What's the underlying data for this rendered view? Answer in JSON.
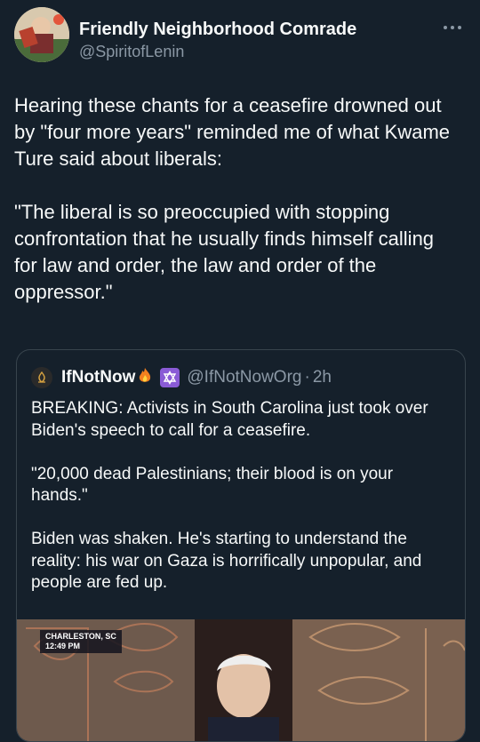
{
  "author": {
    "name": "Friendly Neighborhood Comrade",
    "handle": "@SpiritofLenin"
  },
  "more_icon": "more-horizontal-icon",
  "tweet_text": "Hearing these chants for a ceasefire drowned out by \"four more years\" reminded me of what Kwame Ture said about liberals:\n\n\"The liberal is so preoccupied with stopping confrontation that he usually finds himself calling for law and order, the law and order of the oppressor.\"",
  "quote": {
    "name": "IfNotNow",
    "handle": "@IfNotNowOrg",
    "separator": "·",
    "time": "2h",
    "text": "BREAKING: Activists in South Carolina just took over Biden's speech to call for a ceasefire.\n\n\"20,000 dead Palestinians; their blood is on your hands.\"\n\nBiden was shaken. He's starting to understand the reality: his war on Gaza is horrifically unpopular, and people are fed up.",
    "media": {
      "location": "CHARLESTON, SC",
      "time": "12:49 PM"
    }
  },
  "colors": {
    "background": "#15202b",
    "text": "#f7f9f9",
    "secondary": "#8b98a5",
    "border": "#38444d"
  }
}
